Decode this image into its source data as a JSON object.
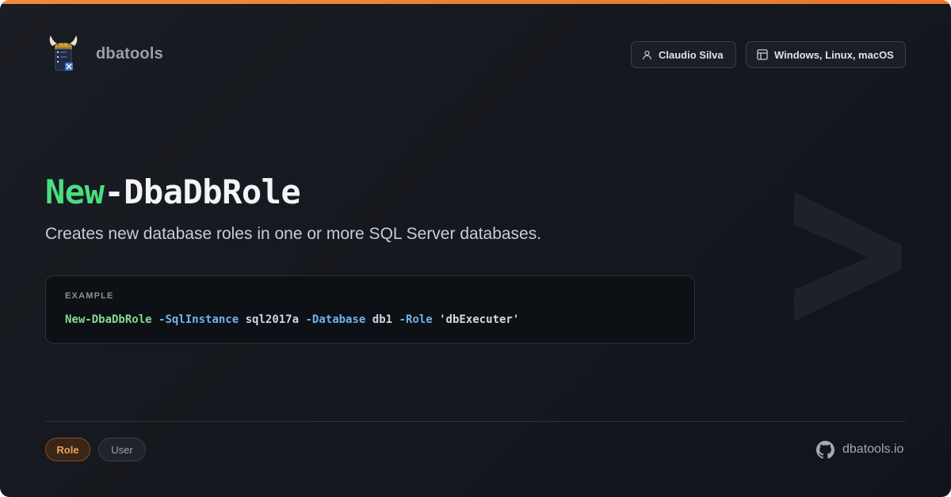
{
  "header": {
    "brand": "dbatools",
    "author": "Claudio Silva",
    "platforms": "Windows, Linux, macOS"
  },
  "command": {
    "verb": "New",
    "noun": "-DbaDbRole",
    "description": "Creates new database roles in one or more SQL Server databases."
  },
  "example": {
    "label": "EXAMPLE",
    "tokens": {
      "cmd": "New-DbaDbRole",
      "p1": "-SqlInstance",
      "v1": "sql2017a",
      "p2": "-Database",
      "v2": "db1",
      "p3": "-Role",
      "v3": "'dbExecuter'"
    }
  },
  "footer": {
    "tags": [
      "Role",
      "User"
    ],
    "site": "dbatools.io"
  },
  "colors": {
    "accent": "#f08a3c",
    "verb": "#4ade80",
    "param": "#6eb3f0",
    "background": "#15181e"
  },
  "icons": {
    "author": "user-icon",
    "platform": "layout-icon",
    "site": "github-icon",
    "logo": "viking-server-logo"
  }
}
